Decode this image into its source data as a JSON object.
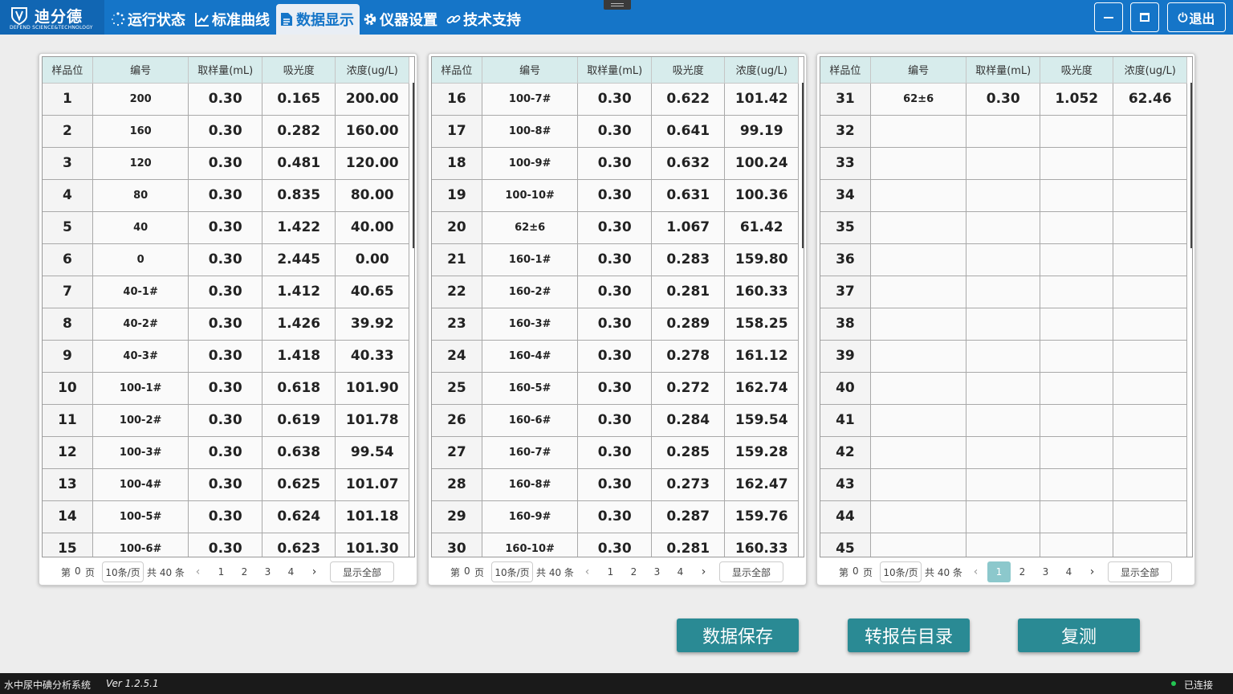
{
  "brand": {
    "name": "迪分德",
    "sub": "DEFEND  SCIENCE&TECHNOLOGY"
  },
  "nav": [
    {
      "label": "运行状态",
      "icon": "spinner-icon"
    },
    {
      "label": "标准曲线",
      "icon": "line-chart-icon"
    },
    {
      "label": "数据显示",
      "icon": "document-icon"
    },
    {
      "label": "仪器设置",
      "icon": "gear-icon"
    },
    {
      "label": "技术支持",
      "icon": "link-icon"
    }
  ],
  "window": {
    "minimize": "—",
    "maximize": "□",
    "exit_label": "退出"
  },
  "columns": [
    "样品位",
    "编号",
    "取样量(mL)",
    "吸光度",
    "浓度(ug/L)"
  ],
  "panels": [
    {
      "rows": [
        [
          "1",
          "200",
          "0.30",
          "0.165",
          "200.00"
        ],
        [
          "2",
          "160",
          "0.30",
          "0.282",
          "160.00"
        ],
        [
          "3",
          "120",
          "0.30",
          "0.481",
          "120.00"
        ],
        [
          "4",
          "80",
          "0.30",
          "0.835",
          "80.00"
        ],
        [
          "5",
          "40",
          "0.30",
          "1.422",
          "40.00"
        ],
        [
          "6",
          "0",
          "0.30",
          "2.445",
          "0.00"
        ],
        [
          "7",
          "40-1#",
          "0.30",
          "1.412",
          "40.65"
        ],
        [
          "8",
          "40-2#",
          "0.30",
          "1.426",
          "39.92"
        ],
        [
          "9",
          "40-3#",
          "0.30",
          "1.418",
          "40.33"
        ],
        [
          "10",
          "100-1#",
          "0.30",
          "0.618",
          "101.90"
        ],
        [
          "11",
          "100-2#",
          "0.30",
          "0.619",
          "101.78"
        ],
        [
          "12",
          "100-3#",
          "0.30",
          "0.638",
          "99.54"
        ],
        [
          "13",
          "100-4#",
          "0.30",
          "0.625",
          "101.07"
        ],
        [
          "14",
          "100-5#",
          "0.30",
          "0.624",
          "101.18"
        ],
        [
          "15",
          "100-6#",
          "0.30",
          "0.623",
          "101.30"
        ]
      ],
      "pager": {
        "page_prefix": "第",
        "page_no": "0",
        "page_suffix": "页",
        "page_size": "10条/页",
        "total": "共 40 条",
        "pages": [
          "1",
          "2",
          "3",
          "4"
        ],
        "active": "",
        "show_all": "显示全部",
        "prev": "‹",
        "next": "›"
      }
    },
    {
      "rows": [
        [
          "16",
          "100-7#",
          "0.30",
          "0.622",
          "101.42"
        ],
        [
          "17",
          "100-8#",
          "0.30",
          "0.641",
          "99.19"
        ],
        [
          "18",
          "100-9#",
          "0.30",
          "0.632",
          "100.24"
        ],
        [
          "19",
          "100-10#",
          "0.30",
          "0.631",
          "100.36"
        ],
        [
          "20",
          "62±6",
          "0.30",
          "1.067",
          "61.42"
        ],
        [
          "21",
          "160-1#",
          "0.30",
          "0.283",
          "159.80"
        ],
        [
          "22",
          "160-2#",
          "0.30",
          "0.281",
          "160.33"
        ],
        [
          "23",
          "160-3#",
          "0.30",
          "0.289",
          "158.25"
        ],
        [
          "24",
          "160-4#",
          "0.30",
          "0.278",
          "161.12"
        ],
        [
          "25",
          "160-5#",
          "0.30",
          "0.272",
          "162.74"
        ],
        [
          "26",
          "160-6#",
          "0.30",
          "0.284",
          "159.54"
        ],
        [
          "27",
          "160-7#",
          "0.30",
          "0.285",
          "159.28"
        ],
        [
          "28",
          "160-8#",
          "0.30",
          "0.273",
          "162.47"
        ],
        [
          "29",
          "160-9#",
          "0.30",
          "0.287",
          "159.76"
        ],
        [
          "30",
          "160-10#",
          "0.30",
          "0.281",
          "160.33"
        ]
      ],
      "pager": {
        "page_prefix": "第",
        "page_no": "0",
        "page_suffix": "页",
        "page_size": "10条/页",
        "total": "共 40 条",
        "pages": [
          "1",
          "2",
          "3",
          "4"
        ],
        "active": "",
        "show_all": "显示全部",
        "prev": "‹",
        "next": "›"
      }
    },
    {
      "rows": [
        [
          "31",
          "62±6",
          "0.30",
          "1.052",
          "62.46"
        ],
        [
          "32",
          "",
          "",
          "",
          ""
        ],
        [
          "33",
          "",
          "",
          "",
          ""
        ],
        [
          "34",
          "",
          "",
          "",
          ""
        ],
        [
          "35",
          "",
          "",
          "",
          ""
        ],
        [
          "36",
          "",
          "",
          "",
          ""
        ],
        [
          "37",
          "",
          "",
          "",
          ""
        ],
        [
          "38",
          "",
          "",
          "",
          ""
        ],
        [
          "39",
          "",
          "",
          "",
          ""
        ],
        [
          "40",
          "",
          "",
          "",
          ""
        ],
        [
          "41",
          "",
          "",
          "",
          ""
        ],
        [
          "42",
          "",
          "",
          "",
          ""
        ],
        [
          "43",
          "",
          "",
          "",
          ""
        ],
        [
          "44",
          "",
          "",
          "",
          ""
        ],
        [
          "45",
          "",
          "",
          "",
          ""
        ]
      ],
      "pager": {
        "page_prefix": "第",
        "page_no": "0",
        "page_suffix": "页",
        "page_size": "10条/页",
        "total": "共 40 条",
        "pages": [
          "1",
          "2",
          "3",
          "4"
        ],
        "active": "1",
        "show_all": "显示全部",
        "prev": "‹",
        "next": "›"
      }
    }
  ],
  "actions": {
    "save": "数据保存",
    "report": "转报告目录",
    "retest": "复测"
  },
  "status": {
    "app": "水中尿中碘分析系统",
    "version": "Ver 1.2.5.1",
    "connection": "已连接"
  },
  "colors": {
    "topbar": "#1575c8",
    "header_bg": "#d7ecec",
    "action": "#2a8a94",
    "active_page": "#8cc8cc",
    "connected": "#23c552"
  }
}
